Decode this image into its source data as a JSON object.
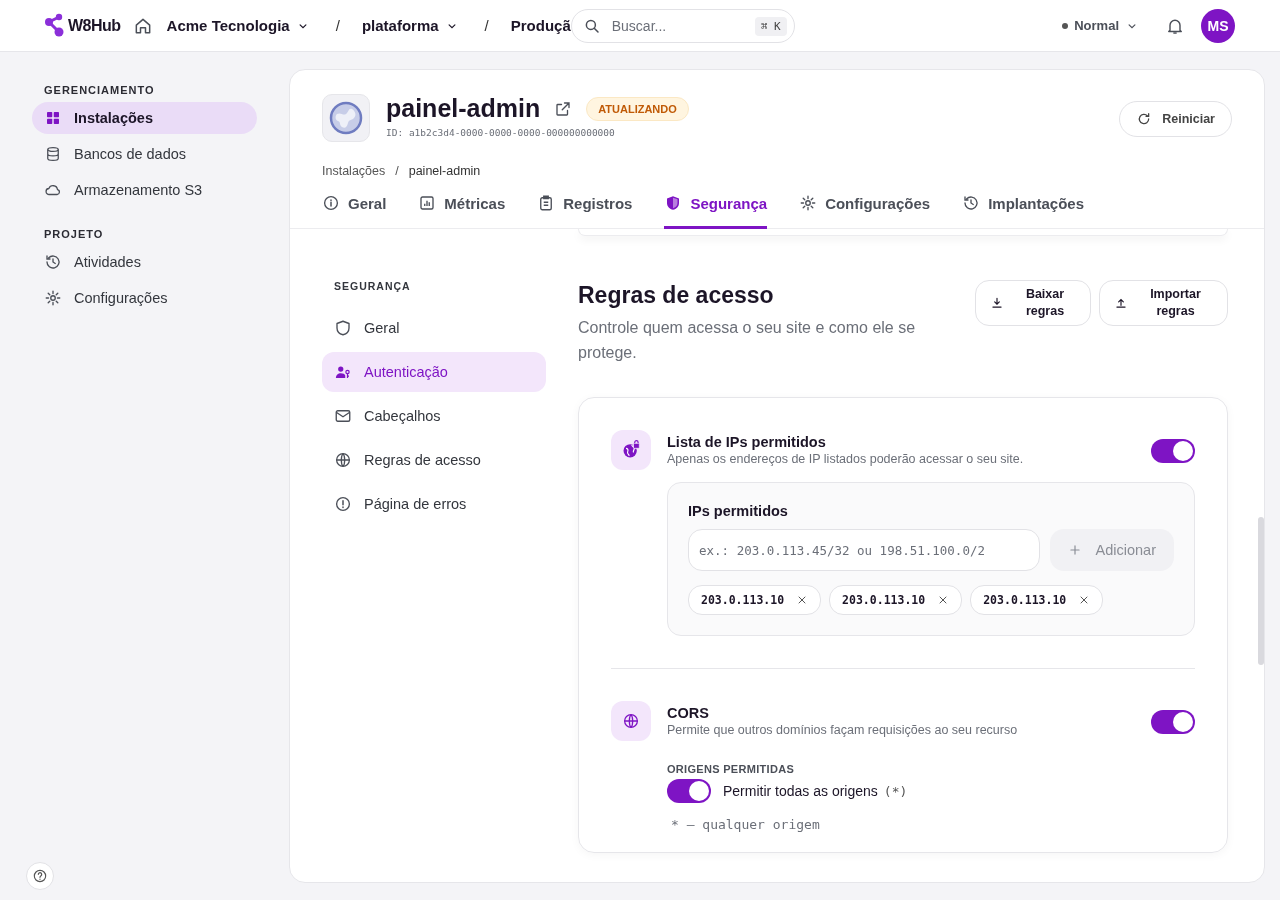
{
  "topbar": {
    "logo": "W8Hub",
    "breadcrumb": [
      {
        "label": "Acme Tecnologia",
        "dropdown": true
      },
      {
        "label": "plataforma",
        "dropdown": true
      },
      {
        "label": "Produçã",
        "dropdown": false
      }
    ],
    "separators": [
      "/",
      "/"
    ],
    "search": {
      "placeholder": "Buscar...",
      "shortcut": "⌘ K"
    },
    "mode": "Normal",
    "avatar": "MS"
  },
  "sidebar": {
    "sections": [
      {
        "title": "GERENCIAMENTO",
        "items": [
          {
            "label": "Instalações",
            "selected": true
          },
          {
            "label": "Bancos de dados",
            "selected": false
          },
          {
            "label": "Armazenamento S3",
            "selected": false
          }
        ]
      },
      {
        "title": "PROJETO",
        "items": [
          {
            "label": "Atividades",
            "selected": false
          },
          {
            "label": "Configurações",
            "selected": false
          }
        ]
      }
    ]
  },
  "app": {
    "name": "painel-admin",
    "status": "ATUALIZANDO",
    "id": "ID: a1b2c3d4-0000-0000-0000-000000000000",
    "restart": "Reiniciar"
  },
  "breadcrumb": [
    "Instalações",
    "/",
    "painel-admin"
  ],
  "tabs": [
    {
      "label": "Geral",
      "selected": false
    },
    {
      "label": "Métricas",
      "selected": false
    },
    {
      "label": "Registros",
      "selected": false
    },
    {
      "label": "Segurança",
      "selected": true
    },
    {
      "label": "Configurações",
      "selected": false
    },
    {
      "label": "Implantações",
      "selected": false
    }
  ],
  "security_nav": {
    "title": "SEGURANÇA",
    "items": [
      {
        "label": "Geral",
        "selected": false
      },
      {
        "label": "Autenticação",
        "selected": true
      },
      {
        "label": "Cabeçalhos",
        "selected": false
      },
      {
        "label": "Regras de acesso",
        "selected": false
      },
      {
        "label": "Página de erros",
        "selected": false
      }
    ]
  },
  "section": {
    "title": "Regras de acesso",
    "subtitle": "Controle quem acessa o seu site e como ele se protege.",
    "buttons": [
      "Baixar regras",
      "Importar regras"
    ]
  },
  "ip_allowlist": {
    "title": "Lista de IPs permitidos",
    "description": "Apenas os endereços de IP listados poderão acessar o seu site.",
    "on": true,
    "field_label": "IPs permitidos",
    "placeholder": "ex.: 203.0.113.45/32 ou 198.51.100.0/2",
    "add_button": "Adicionar",
    "add_disabled": true,
    "ips": [
      "203.0.113.10",
      "203.0.113.10",
      "203.0.113.10"
    ]
  },
  "cors": {
    "title": "CORS",
    "description": "Permite que outros domínios façam requisições ao seu recurso",
    "on": true,
    "origins_label": "ORIGENS PERMITIDAS",
    "allow_all": {
      "label": "Permitir todas as origens",
      "code": "(*)",
      "on": true
    },
    "hint": "* — qualquer origem"
  }
}
